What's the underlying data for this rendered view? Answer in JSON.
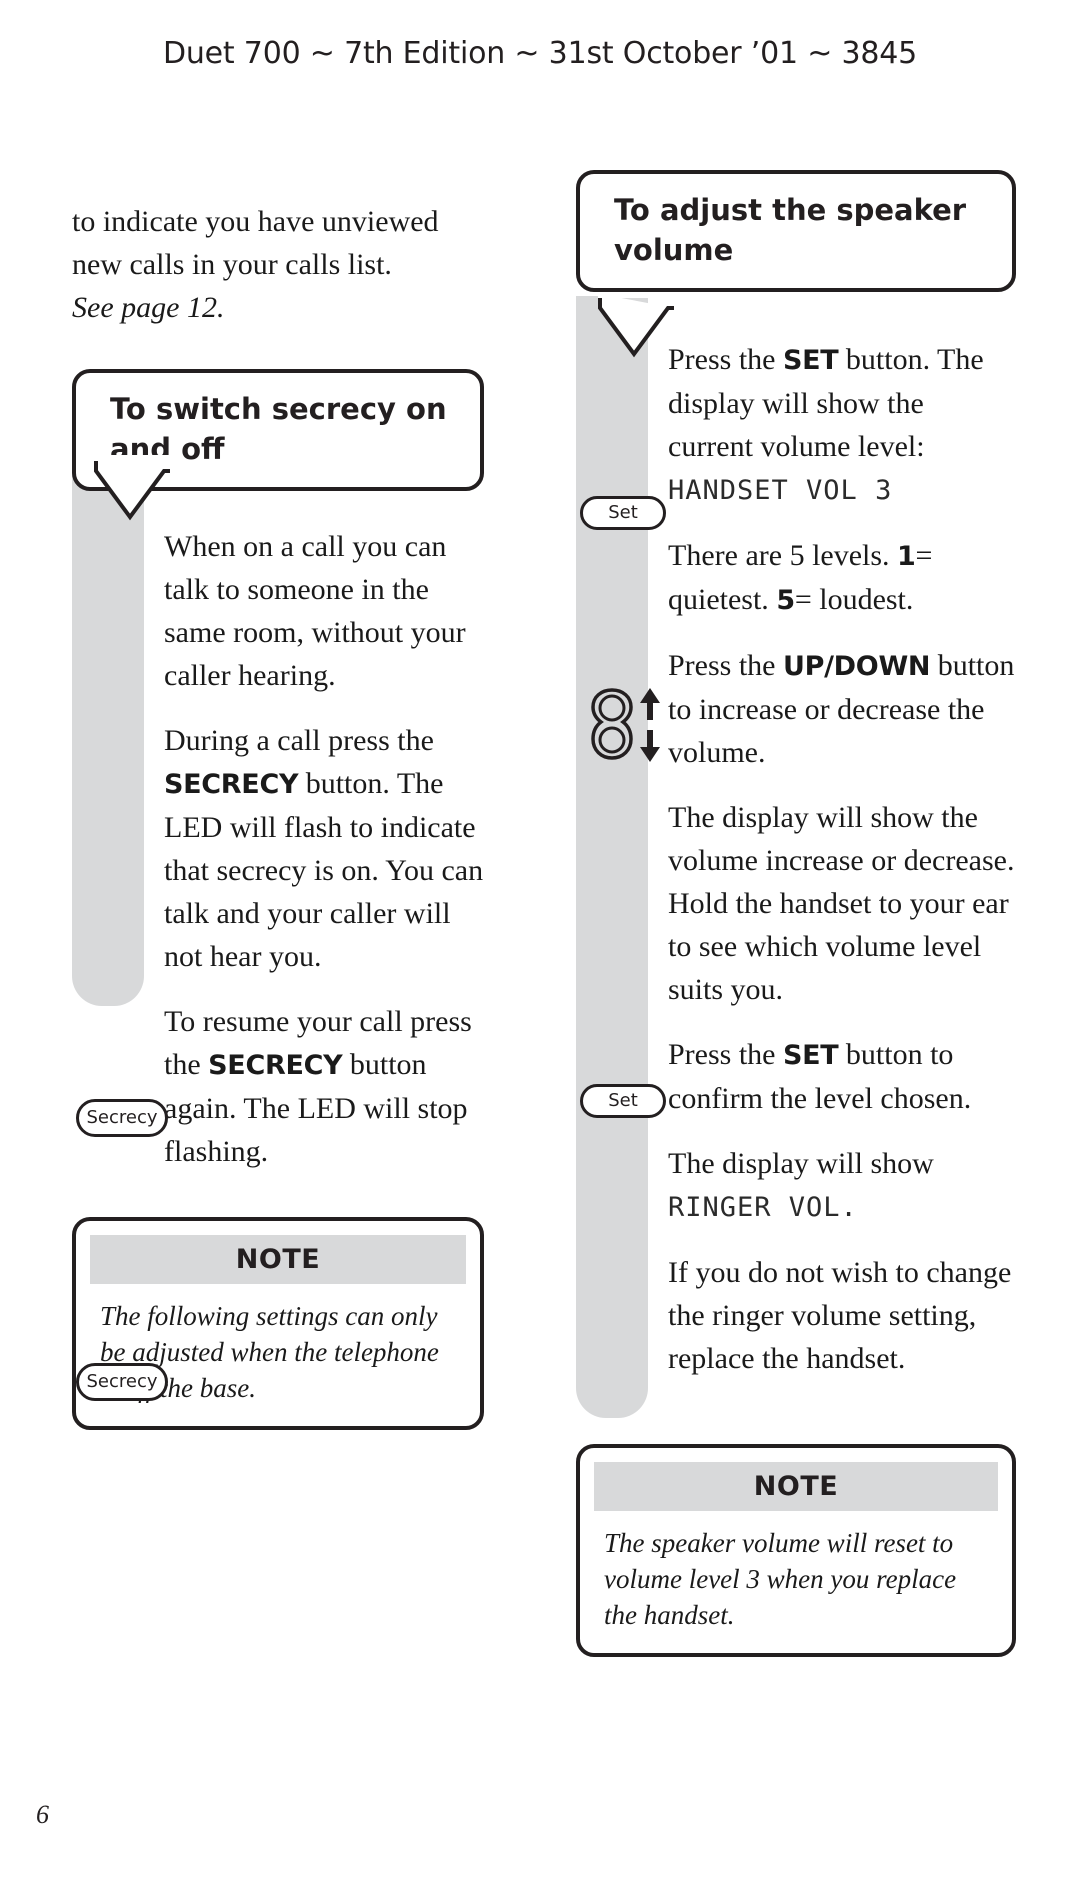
{
  "page": {
    "running_header": "Duet 700 ~ 7th Edition ~ 31st October ’01 ~ 3845",
    "folio": "6"
  },
  "left_column": {
    "intro": {
      "line1": "to indicate you have unviewed new calls in your calls list.",
      "line2_italic": "See page 12."
    },
    "callout": {
      "title": "To switch secrecy on and off"
    },
    "steps": [
      {
        "key": null,
        "text": "When on a call you can talk to someone in the same room, without your caller hearing."
      },
      {
        "key": "Secrecy",
        "text_before": "During a call press the ",
        "bold": "SECRECY",
        "text_after": " button. The LED will flash to indicate that secrecy is on. You can talk and your caller will not hear you."
      },
      {
        "key": "Secrecy",
        "text_before": "To resume your call press the ",
        "bold": "SECRECY",
        "text_after": " button again. The LED will stop flashing."
      }
    ],
    "note": {
      "heading": "NOTE",
      "body": "The following settings can only be adjusted when the telephone is off the base."
    }
  },
  "right_column": {
    "callout": {
      "title": "To adjust the speaker volume"
    },
    "steps": [
      {
        "key": "Set",
        "text_before": "Press the ",
        "bold": "SET",
        "text_after": " button. The display will show the current volume level: ",
        "lcd": "HANDSET VOL 3"
      },
      {
        "key": null,
        "text_before": "There are 5 levels. ",
        "bold1": "1",
        "mid1": "= quietest. ",
        "bold2": "5",
        "mid2": "= loudest."
      },
      {
        "key": "updown",
        "text_before": "Press the ",
        "bold": "UP/DOWN",
        "text_after": " button to increase or decrease the volume."
      },
      {
        "key": null,
        "text": "The display will show the volume increase or decrease. Hold the handset to your ear to see which volume level suits you."
      },
      {
        "key": "Set",
        "text_before": "Press the ",
        "bold": "SET",
        "text_after": " button to confirm the level chosen."
      },
      {
        "key": null,
        "text_before": "The display will show ",
        "lcd": "RINGER VOL."
      },
      {
        "key": null,
        "text": "If you do not wish to change the ringer volume setting, replace the handset."
      }
    ],
    "note": {
      "heading": "NOTE",
      "body": "The speaker volume will reset to volume level 3 when you replace the handset."
    }
  },
  "colors": {
    "ink": "#231f20",
    "rail_grey": "#d8d9da",
    "paper": "#ffffff"
  }
}
